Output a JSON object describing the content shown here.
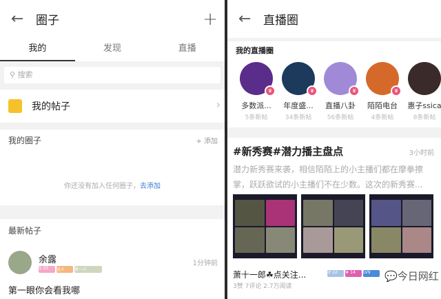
{
  "left": {
    "title": "圈子",
    "tabs": [
      {
        "label": "我的"
      },
      {
        "label": "发现"
      },
      {
        "label": "直播"
      }
    ],
    "search_placeholder": "搜索",
    "my_posts": "我的帖子",
    "my_circles": "我的圈子",
    "add_label": "+ 添加",
    "empty_text": "你还没有加入任何圈子，",
    "empty_link": "去添加",
    "latest_posts": "最新帖子",
    "post": {
      "author": "余露",
      "time": "1分钟前",
      "content": "第一眼你会看我哪",
      "tags": [
        "♀ 25",
        "达人",
        "新一人"
      ]
    }
  },
  "right": {
    "title": "直播圈",
    "section": "我的直播圈",
    "circles": [
      {
        "name": "多数派...",
        "count": "5条新帖",
        "color": "#5a2d8a"
      },
      {
        "name": "年度盛...",
        "count": "34条新帖",
        "color": "#1c3a5c"
      },
      {
        "name": "直播八卦",
        "count": "56条新帖",
        "color": "#a08ad8"
      },
      {
        "name": "陌陌电台",
        "count": "4条新帖",
        "color": "#d5692a"
      },
      {
        "name": "惠子ssica",
        "count": "8条新帖",
        "color": "#3a2a2a"
      }
    ],
    "post": {
      "title": "#新秀赛#潜力播主盘点",
      "time": "3小时前",
      "body": "潜力新秀赛来袭，相信陌陌上的小主播们都在摩拳擦掌，跃跃欲试的小主播们不在少数。这次的新秀赛...",
      "author": "萧十一郎☘点关注...",
      "stats": "3赞  7评论  2.7万阅读",
      "tags": [
        "♂ 22",
        "★ 14",
        "LV9"
      ]
    },
    "watermark": "今日网红"
  }
}
